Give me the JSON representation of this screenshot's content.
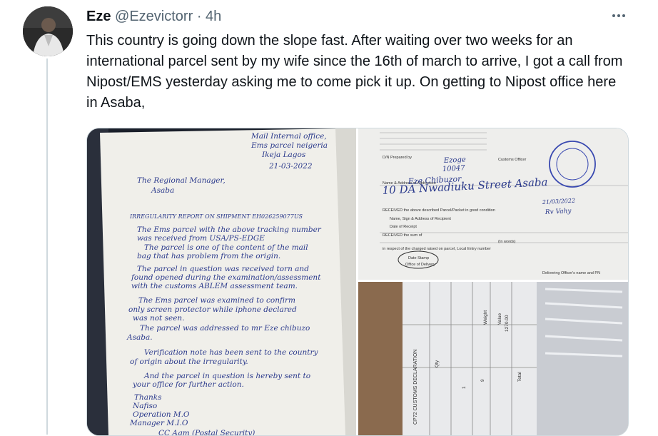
{
  "tweet": {
    "name": "Eze",
    "handle": "@Ezevictorr",
    "separator": "·",
    "time": "4h",
    "text": "This country is going down the slope fast. After waiting over two weeks for an international parcel sent by my wife since the 16th of march to arrive, I got a call from Nipost/EMS yesterday asking me to come pick it up. On getting to Nipost office here in Asaba,"
  },
  "icons": {
    "avatar": "user-avatar",
    "more": "more-options-icon"
  },
  "images": {
    "letter": {
      "lines": [
        "Mail Internal office,",
        "Ems parcel neigeria",
        "Ikeja Lagos",
        "21-03-2022",
        "The Regional Manager,",
        "Asaba",
        "IRREGULARITY REPORT ON SHIPMENT EH026259077US",
        "The Ems parcel with the above tracking number",
        "was received from USA/PS-EDGE",
        "The parcel is one of the content of the mail",
        "bag that has problem from the origin.",
        "The parcel in question was received torn and",
        "found opened during the examination/assessment",
        "with the customs ABLEM assessment team.",
        "The Ems parcel was examined to confirm",
        "only screen protector while iphone declared",
        "was not seen.",
        "The parcel was addressed to mr Eze chibuzo",
        "Asaba.",
        "Verification note has been sent to the country",
        "of origin about the irregularity.",
        "And the parcel in question is hereby sent to",
        "your office for further action.",
        "Thanks",
        "Nafiso",
        "Operation M.O",
        "Manager M.I.O",
        "CC Agm (Postal Security)"
      ]
    },
    "delivery_slip": {
      "printed": [
        "Customs Officer",
        "D/N Prepared by",
        "Name & Address of Addressee",
        "RECEIVED the above described Parcel/Packet in good condition",
        "Name, Sign & Address of Recipient",
        "Date of Receipt",
        "RECEIVED the sum of",
        "(In words)",
        "in respect of the charged raised on parcel, Local Entry number",
        "Date Stamp",
        "Office of Delivery",
        "Delivering Officer's name and PN"
      ],
      "handwritten": [
        "Ezoge",
        "10047",
        "Eze Chibuzor",
        "10 DA Nwadiuku Street Asaba",
        "21/03/2022",
        "Rv Vahy"
      ]
    },
    "customs_form": {
      "printed": [
        "CP72 CUSTOMS DECLARATION",
        "Weight",
        "Value",
        "Qty",
        "Total",
        "1",
        "9",
        "1270.00"
      ]
    }
  },
  "colors": {
    "text": "#0f1419",
    "secondary": "#536471",
    "border": "#cfd9de",
    "ink": "#2b3a8c"
  }
}
